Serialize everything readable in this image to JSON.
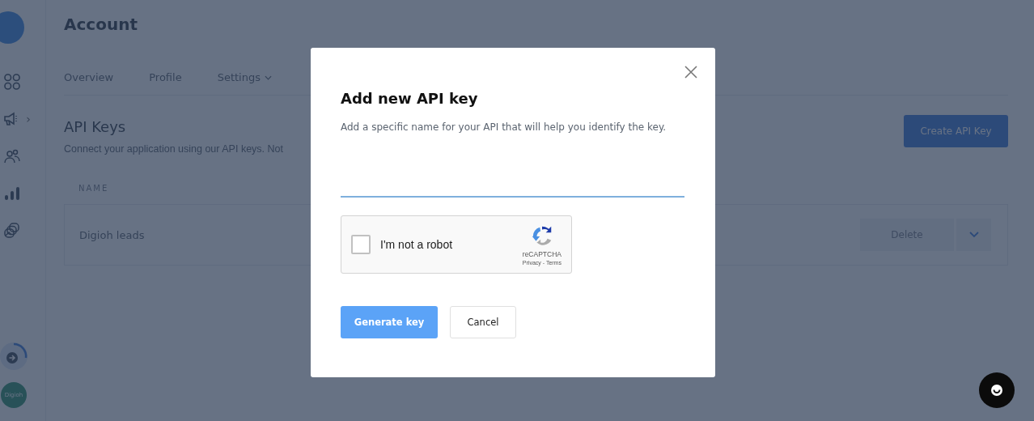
{
  "sidebar": {
    "expand_arrow": "›",
    "avatar_label": "Digioh"
  },
  "page": {
    "title": "Account",
    "tabs": [
      {
        "label": "Overview",
        "dropdown": false
      },
      {
        "label": "Profile",
        "dropdown": false
      },
      {
        "label": "Settings",
        "dropdown": true
      }
    ],
    "section_title": "API Keys",
    "section_text": "Connect your application using our API keys. Not",
    "create_button": "Create API Key",
    "table": {
      "columns": [
        "NAME"
      ],
      "rows": [
        {
          "name": "Digioh leads",
          "action": "Delete"
        }
      ]
    }
  },
  "modal": {
    "title": "Add new API key",
    "description": "Add a specific name for your API that will help you identify the key.",
    "captcha": {
      "label": "I'm not a robot",
      "checked": false,
      "brand": "reCAPTCHA",
      "links": "Privacy - Terms"
    },
    "buttons": [
      {
        "label": "Generate key",
        "kind": "primary"
      },
      {
        "label": "Cancel",
        "kind": "secondary"
      }
    ]
  }
}
